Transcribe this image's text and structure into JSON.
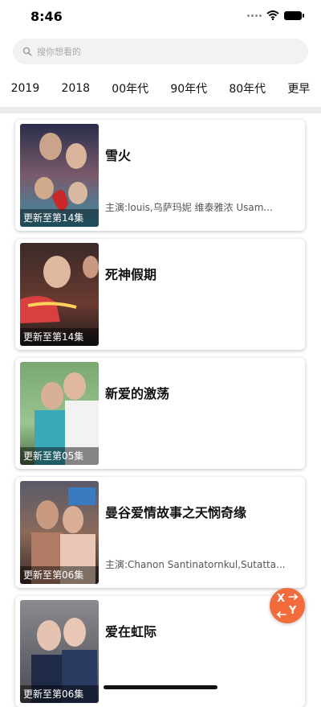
{
  "status_bar": {
    "time": "8:46"
  },
  "search": {
    "placeholder": "搜你想看的"
  },
  "year_tabs": [
    "2019",
    "2018",
    "00年代",
    "90年代",
    "80年代",
    "更早"
  ],
  "shows": [
    {
      "title": "雪火",
      "update": "更新至第14集",
      "cast": "主演:louis,乌萨玛妮 维泰雅浓 Usam..."
    },
    {
      "title": "死神假期",
      "update": "更新至第14集",
      "cast": ""
    },
    {
      "title": "新爱的激荡",
      "update": "更新至第05集",
      "cast": ""
    },
    {
      "title": "曼谷爱情故事之天悯奇缘",
      "update": "更新至第06集",
      "cast": "主演:Chanon Santinatornkul,Sutatta..."
    },
    {
      "title": "爱在虹际",
      "update": "更新至第06集",
      "cast": ""
    }
  ],
  "float_button": {
    "x": "X",
    "y": "Y",
    "color": "#f26b3a"
  }
}
